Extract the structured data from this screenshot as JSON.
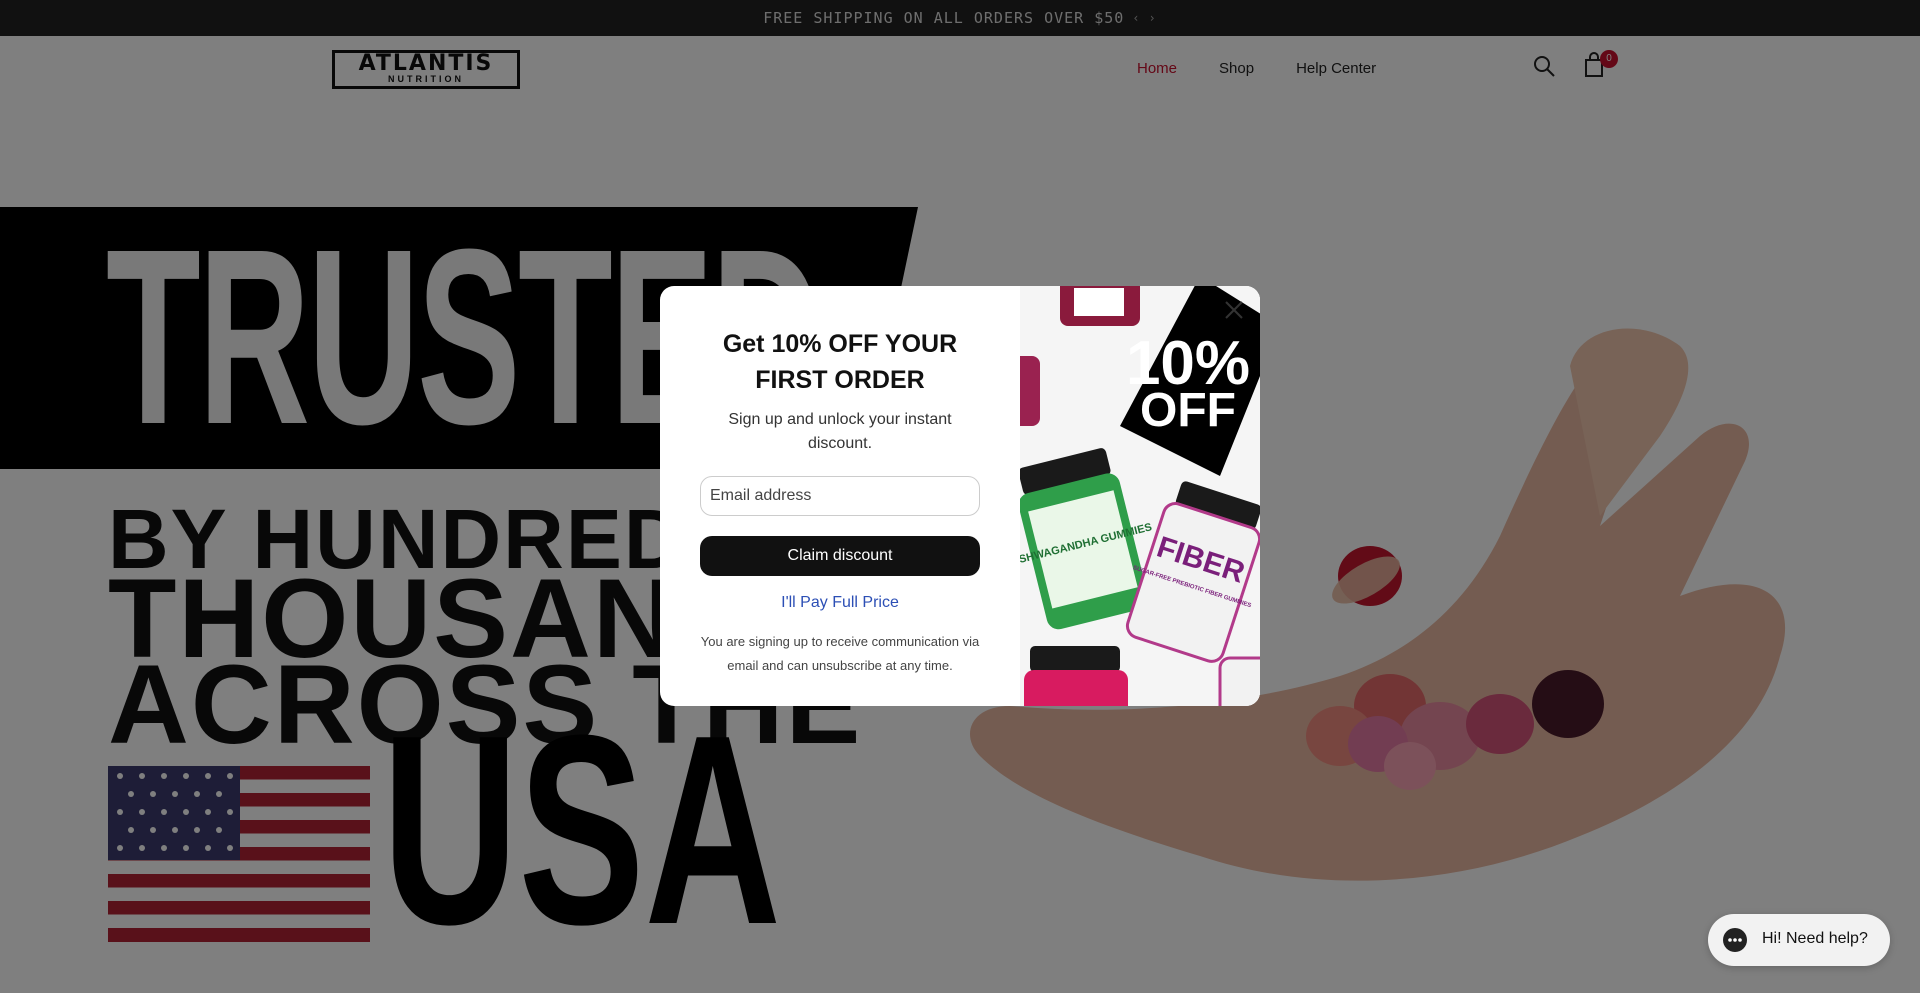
{
  "announcement": {
    "text": "FREE SHIPPING ON ALL ORDERS OVER $50",
    "icons": [
      "chevron-left-icon",
      "chevron-right-icon"
    ]
  },
  "header": {
    "logo_main": "ATLANTIS",
    "logo_sub": "NUTRITION",
    "nav": [
      {
        "label": "Home",
        "active": true
      },
      {
        "label": "Shop",
        "active": false
      },
      {
        "label": "Help Center",
        "active": false
      }
    ],
    "cart_count": "0",
    "icons": [
      "search-icon",
      "cart-icon"
    ]
  },
  "hero": {
    "line_trusted": "TRUSTED",
    "line_1": "BY HUNDREDS",
    "line_2": "THOUSANDS",
    "line_3": "ACROSS THE",
    "line_usa": "USA"
  },
  "modal": {
    "title": "Get 10% OFF YOUR FIRST ORDER",
    "subtitle": "Sign up and unlock your instant discount.",
    "email_placeholder": "Email address",
    "claim_label": "Claim discount",
    "decline_label": "I'll Pay Full Price",
    "fine_print": "You are signing up to receive communication via email and can unsubscribe at any time.",
    "promo_badge_line1": "10%",
    "promo_badge_line2": "OFF",
    "product_labels": [
      "ASHWAGANDHA GUMMIES",
      "FIBER",
      "SUGAR-FREE PREBIOTIC FIBER GUMMIES"
    ]
  },
  "chat": {
    "label": "Hi! Need help?"
  },
  "colors": {
    "accent": "#c8102e",
    "link": "#2c4fb5",
    "dark": "#111111"
  }
}
